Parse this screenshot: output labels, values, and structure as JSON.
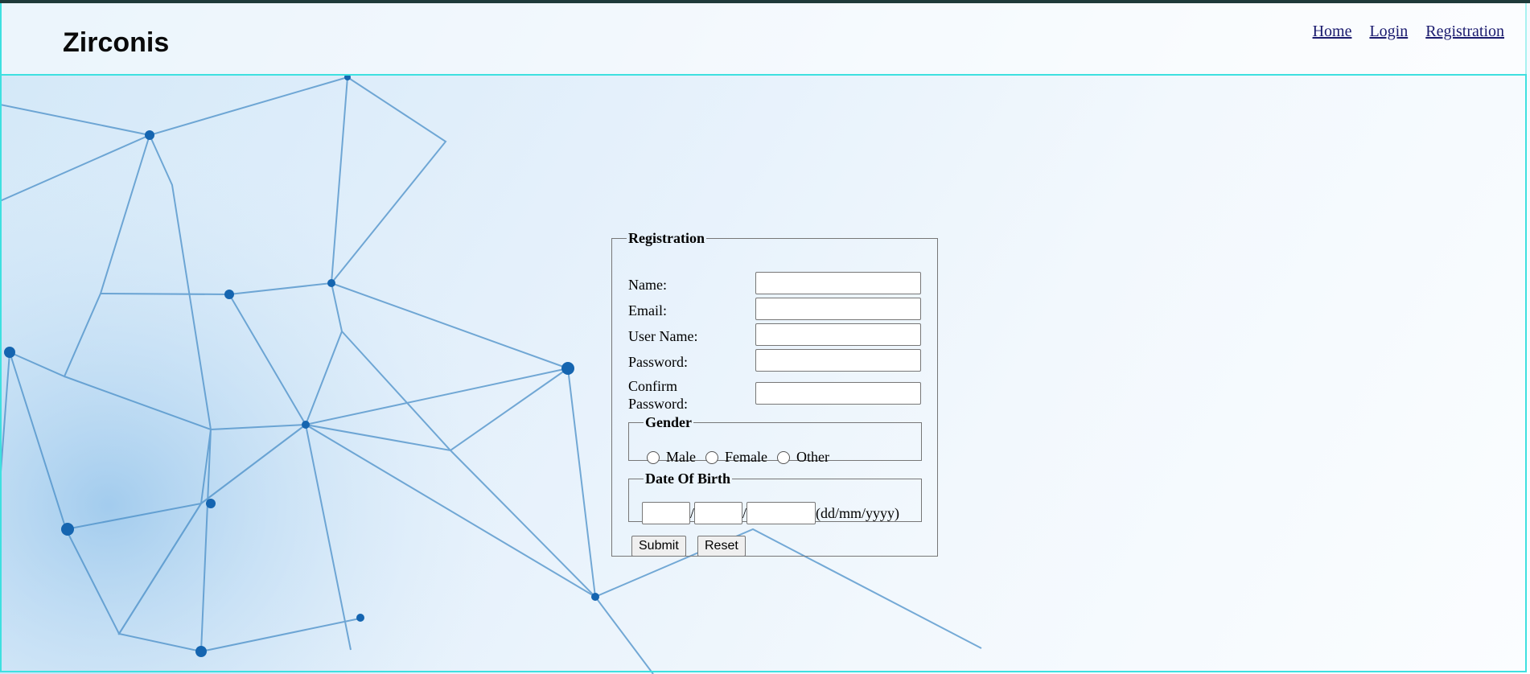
{
  "header": {
    "logo": "Zirconis",
    "nav": [
      {
        "label": "Home"
      },
      {
        "label": "Login"
      },
      {
        "label": "Registration"
      }
    ]
  },
  "form": {
    "legend": "Registration",
    "fields": {
      "name": {
        "label": "Name:",
        "value": ""
      },
      "email": {
        "label": "Email:",
        "value": ""
      },
      "username": {
        "label": "User Name:",
        "value": ""
      },
      "password": {
        "label": "Password:",
        "value": ""
      },
      "confirm_password": {
        "label_line1": "Confirm",
        "label_line2": "Password:",
        "value": ""
      }
    },
    "gender": {
      "legend": "Gender",
      "options": [
        "Male",
        "Female",
        "Other"
      ]
    },
    "dob": {
      "legend": "Date Of Birth",
      "separator": "/",
      "hint": "(dd/mm/yyyy)"
    },
    "buttons": {
      "submit": "Submit",
      "reset": "Reset"
    }
  },
  "colors": {
    "frame_border": "#3ee0e0",
    "link": "#1a1a6e"
  }
}
